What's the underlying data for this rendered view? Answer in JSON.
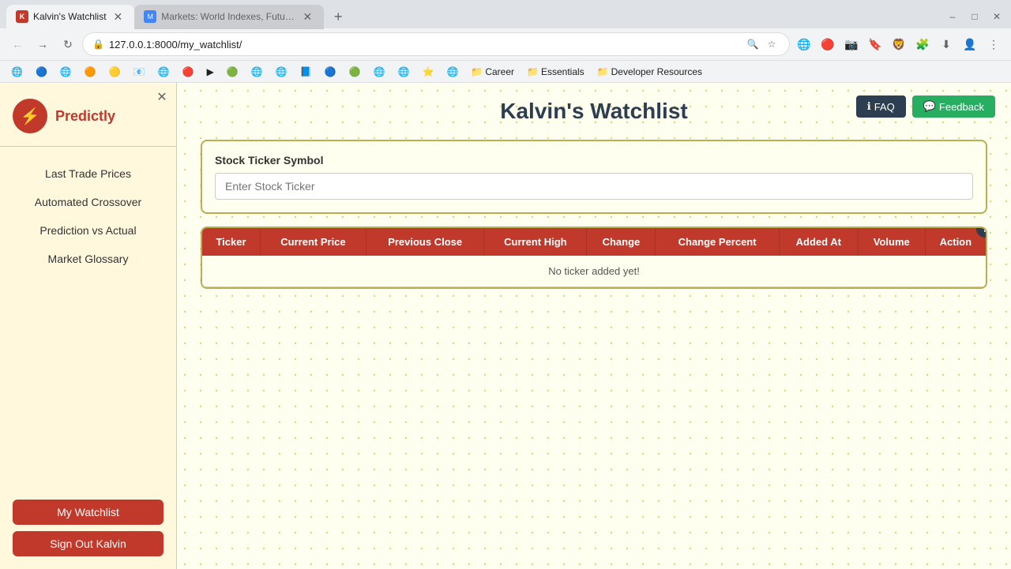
{
  "browser": {
    "tabs": [
      {
        "id": "tab1",
        "title": "Kalvin's Watchlist",
        "url": "127.0.0.1:8000/my_watchlist/",
        "active": true,
        "favicon": "K"
      },
      {
        "id": "tab2",
        "title": "Markets: World Indexes, Future...",
        "url": "",
        "active": false,
        "favicon": "M"
      }
    ],
    "address": "127.0.0.1:8000/my_watchlist/",
    "bookmarks": [
      {
        "label": "",
        "icon": "🌐"
      },
      {
        "label": "",
        "icon": "🔵"
      },
      {
        "label": "",
        "icon": "🌐"
      },
      {
        "label": "",
        "icon": "🔶"
      },
      {
        "label": "",
        "icon": "🟡"
      },
      {
        "label": "",
        "icon": "📧"
      },
      {
        "label": "",
        "icon": "🌐"
      },
      {
        "label": "",
        "icon": "🔴"
      },
      {
        "label": "",
        "icon": "▶"
      },
      {
        "label": "",
        "icon": "🟢"
      },
      {
        "label": "",
        "icon": "🌐"
      },
      {
        "label": "",
        "icon": "🌐"
      },
      {
        "label": "",
        "icon": "📘"
      },
      {
        "label": "",
        "icon": "🔵"
      },
      {
        "label": "",
        "icon": "🟢"
      },
      {
        "label": "",
        "icon": "🌐"
      },
      {
        "label": "",
        "icon": "🌐"
      },
      {
        "label": "",
        "icon": "⭐"
      },
      {
        "label": "",
        "icon": "🌐"
      },
      {
        "label": "Career",
        "icon": "📁"
      },
      {
        "label": "Essentials",
        "icon": "📁"
      },
      {
        "label": "Developer Resources",
        "icon": "📁"
      }
    ]
  },
  "sidebar": {
    "logo_text": "Predictly",
    "logo_icon": "⚡",
    "nav_items": [
      {
        "label": "Last Trade Prices",
        "id": "last-trade-prices"
      },
      {
        "label": "Automated Crossover",
        "id": "automated-crossover"
      },
      {
        "label": "Prediction vs Actual",
        "id": "prediction-vs-actual"
      },
      {
        "label": "Market Glossary",
        "id": "market-glossary"
      }
    ],
    "watchlist_btn": "My Watchlist",
    "signout_btn": "Sign Out Kalvin"
  },
  "page": {
    "title": "Kalvin's Watchlist",
    "faq_btn": "FAQ",
    "feedback_btn": "Feedback",
    "stock_form": {
      "label": "Stock Ticker Symbol",
      "input_placeholder": "Enter Stock Ticker"
    },
    "table": {
      "columns": [
        "Ticker",
        "Current Price",
        "Previous Close",
        "Current High",
        "Change",
        "Change Percent",
        "Added At",
        "Volume",
        "Action"
      ],
      "empty_message": "No ticker added yet!"
    }
  }
}
